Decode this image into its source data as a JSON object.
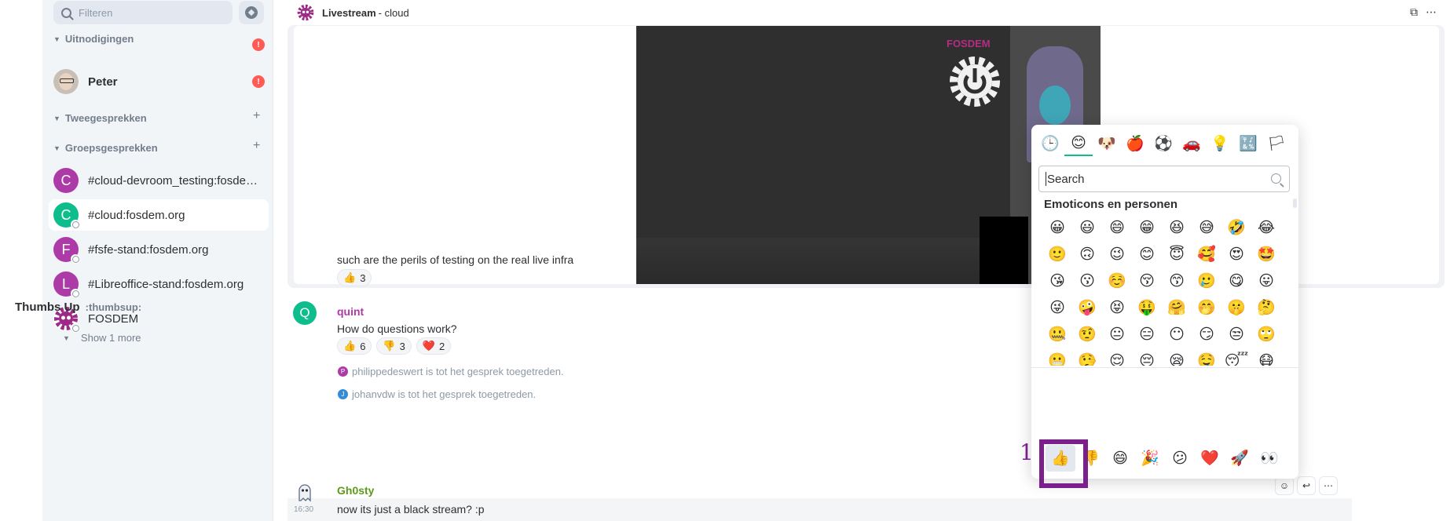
{
  "sidebar": {
    "filter_placeholder": "Filteren",
    "sections": {
      "invites": "Uitnodigingen",
      "invites_badge": "!",
      "dms": "Tweegesprekken",
      "groups": "Groepsgesprekken"
    },
    "invite_room": {
      "name": "Peter",
      "badge": "!"
    },
    "rooms": [
      {
        "letter": "C",
        "name": "#cloud-devroom_testing:fosde…",
        "color": "#ac3ba8"
      },
      {
        "letter": "C",
        "name": "#cloud:fosdem.org",
        "color": "#0dbd8b"
      },
      {
        "letter": "F",
        "name": "#fsfe-stand:fosdem.org",
        "color": "#ac3ba8"
      },
      {
        "letter": "L",
        "name": "#Libreoffice-stand:fosdem.org",
        "color": "#ac3ba8"
      },
      {
        "letter": "",
        "name": "FOSDEM",
        "color": "#ffffff"
      }
    ],
    "show_more": "Show 1 more"
  },
  "header": {
    "title": "Livestream",
    "subtitle": "- cloud"
  },
  "video": {
    "overlay_text": "FOSDEM"
  },
  "timeline": {
    "msg1": {
      "text": "such are the perils of testing on the real live infra",
      "reactions": [
        {
          "emoji": "👍",
          "count": "3"
        }
      ]
    },
    "msg2": {
      "avatar": "Q",
      "sender": "quint",
      "sender_color": "#ac3ba8",
      "text": "How do questions work?",
      "reactions": [
        {
          "emoji": "👍",
          "count": "6"
        },
        {
          "emoji": "👎",
          "count": "3"
        },
        {
          "emoji": "❤️",
          "count": "2"
        }
      ]
    },
    "events": [
      {
        "letter": "P",
        "color": "#ac3ba8",
        "text": "philippedeswert is tot het gesprek toegetreden."
      },
      {
        "letter": "J",
        "color": "#368bd6",
        "text": "johanvdw is tot het gesprek toegetreden."
      }
    ],
    "msg3": {
      "sender": "Gh0sty",
      "sender_color": "#5c9a1a",
      "time": "16:30",
      "text": "now its just a black stream? :p"
    }
  },
  "emoji_picker": {
    "search_placeholder": "Search",
    "category_title": "Emoticons en personen",
    "categories": [
      "🕒",
      "😊",
      "🐶",
      "🍎",
      "⚽",
      "🚗",
      "💡",
      "🔣",
      "🏳"
    ],
    "emojis": [
      "😀",
      "😃",
      "😄",
      "😁",
      "😆",
      "😅",
      "🤣",
      "😂",
      "🙂",
      "🙃",
      "😉",
      "😊",
      "😇",
      "🥰",
      "😍",
      "🤩",
      "😘",
      "😗",
      "☺️",
      "😚",
      "😙",
      "🥲",
      "😋",
      "😛",
      "😜",
      "🤪",
      "😝",
      "🤑",
      "🤗",
      "🤭",
      "🤫",
      "🤔",
      "🤐",
      "🤨",
      "😐",
      "😑",
      "😶",
      "😏",
      "😒",
      "🙄",
      "😬",
      "🤥",
      "😌",
      "😔",
      "😪",
      "🤤",
      "😴",
      "😷",
      "🤒",
      "🤕",
      "🤢",
      "🤮",
      "🤧",
      "🥵",
      "🥶",
      "🥴",
      "😵",
      "🤯",
      "🤠",
      "🥳",
      "🥸",
      "😎",
      "🤓",
      "🧐"
    ],
    "preview_name": "Thumbs Up",
    "preview_shortcode": ":thumbsup:",
    "quick_reactions": [
      "👍",
      "👎",
      "😄",
      "🎉",
      "😕",
      "❤️",
      "🚀",
      "👀"
    ]
  },
  "annotation": {
    "label": "1",
    "color": "#7b1f8c"
  }
}
